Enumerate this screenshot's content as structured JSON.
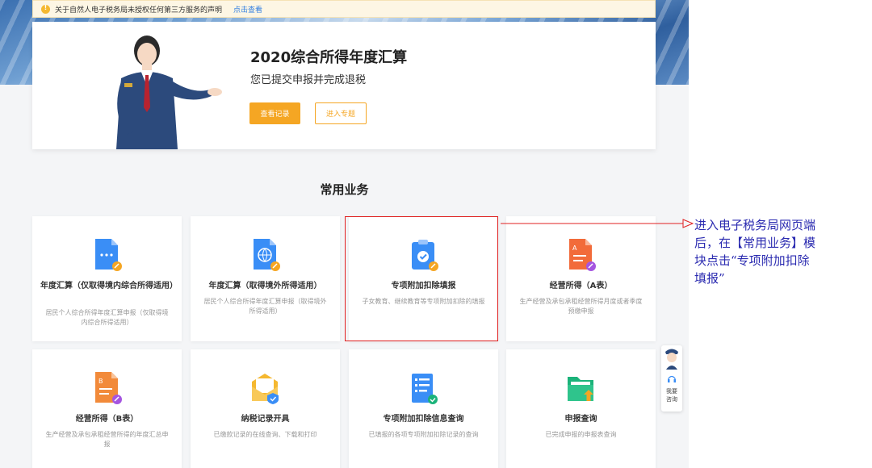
{
  "notice": {
    "text": "关于自然人电子税务局未授权任何第三方服务的声明",
    "link": "点击查看"
  },
  "hero": {
    "title": "2020综合所得年度汇算",
    "subtitle": "您已提交申报并完成退税",
    "primary_button": "查看记录",
    "secondary_button": "进入专题"
  },
  "section_title": "常用业务",
  "services": [
    {
      "title": "年度汇算（仅取得境内综合所得适用）",
      "desc": "居民个人综合所得年度汇算申报（仅取得境内综合所得适用）",
      "icon": "document-icon",
      "color": "#3a8ef6"
    },
    {
      "title": "年度汇算（取得境外所得适用）",
      "desc": "居民个人综合所得年度汇算申报（取得境外所得适用）",
      "icon": "globe-document-icon",
      "color": "#3a8ef6"
    },
    {
      "title": "专项附加扣除填报",
      "desc": "子女教育、继续教育等专项附加扣除的填报",
      "icon": "clipboard-check-icon",
      "color": "#3a8ef6"
    },
    {
      "title": "经营所得（A表）",
      "desc": "生产经营及承包承租经营所得月度或者季度预缴申报",
      "icon": "form-a-icon",
      "color": "#f26b3a"
    },
    {
      "title": "经营所得（B表）",
      "desc": "生产经营及承包承租经营所得的年度汇总申报",
      "icon": "form-b-icon",
      "color": "#f28a3a"
    },
    {
      "title": "纳税记录开具",
      "desc": "已缴款记录的在线查询、下载和打印",
      "icon": "envelope-shield-icon",
      "color": "#f5b830"
    },
    {
      "title": "专项附加扣除信息查询",
      "desc": "已填报的各项专项附加扣除记录的查询",
      "icon": "list-check-icon",
      "color": "#3a8ef6"
    },
    {
      "title": "申报查询",
      "desc": "已完成申报的申报表查询",
      "icon": "folder-upload-icon",
      "color": "#1bb37a"
    }
  ],
  "float_widget": {
    "line1": "我要",
    "line2": "咨询"
  },
  "annotation": {
    "lines": [
      "进入电子税务局网页端",
      "后，在【常用业务】模",
      "块点击“专项附加扣除",
      "填报”"
    ]
  },
  "colors": {
    "accent": "#f5a623",
    "highlight": "#e02020",
    "annotation": "#2a2ab0"
  }
}
